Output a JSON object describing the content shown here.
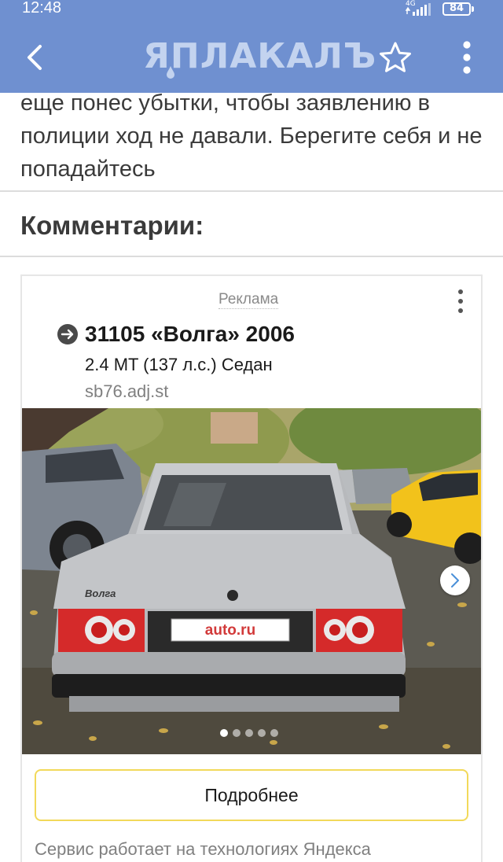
{
  "status_bar": {
    "time": "12:48",
    "network": "4G",
    "battery": "84"
  },
  "header": {
    "logo": "ЯПЛАКАЛЪ",
    "background_color": "#6f90d0",
    "back_icon": "chevron-left-icon",
    "star_icon": "star-outline-icon",
    "menu_icon": "more-vertical-icon"
  },
  "article": {
    "text": "еще понес убытки, чтобы заявлению в полиции ход не давали. Берегите себя и не попадайтесь"
  },
  "comments": {
    "heading": "Комментарии:"
  },
  "ad": {
    "label": "Реклама",
    "title": "31105 «Волга» 2006",
    "subtitle": "2.4 MT (137 л.с.) Седан",
    "domain": "sb76.adj.st",
    "photo": {
      "badge_text": "Волга",
      "plate_text": "auto.ru",
      "slides_total": 5,
      "slide_active": 1
    },
    "button_label": "Подробнее",
    "footer": "Сервис работает на технологиях Яндекса",
    "accent_color": "#f2d95a"
  }
}
